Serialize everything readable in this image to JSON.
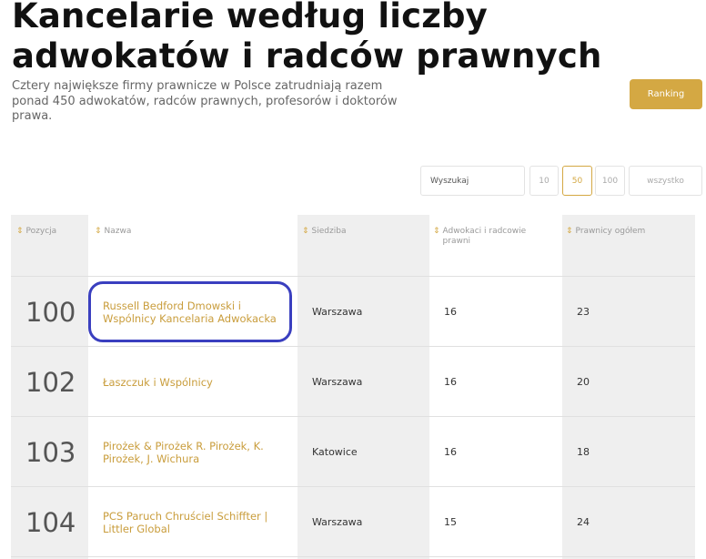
{
  "header": {
    "title": "Kancelarie według liczby adwokatów i radców prawnych",
    "subtitle": "Cztery największe firmy prawnicze w Polsce zatrudniają razem ponad 450 adwokatów, radców prawnych, profesorów i doktorów prawa.",
    "ranking_label": "Ranking"
  },
  "controls": {
    "search_placeholder": "Wyszukaj",
    "page_sizes": [
      "10",
      "50",
      "100",
      "wszystko"
    ],
    "active_page_size": "50"
  },
  "table": {
    "columns": [
      "Pozycja",
      "Nazwa",
      "Siedziba",
      "Adwokaci i radcowie prawni",
      "Prawnicy ogółem"
    ],
    "rows": [
      {
        "pos": "100",
        "name": "Russell Bedford Dmowski i Wspólnicy Kancelaria Adwokacka",
        "city": "Warszawa",
        "lawyers": "16",
        "total": "23"
      },
      {
        "pos": "102",
        "name": "Łaszczuk i Wspólnicy",
        "city": "Warszawa",
        "lawyers": "16",
        "total": "20"
      },
      {
        "pos": "103",
        "name": "Pirożek & Pirożek R. Pirożek, K. Pirożek, J. Wichura",
        "city": "Katowice",
        "lawyers": "16",
        "total": "18"
      },
      {
        "pos": "104",
        "name": "PCS Paruch Chruściel Schiffter | Littler Global",
        "city": "Warszawa",
        "lawyers": "15",
        "total": "24"
      }
    ]
  },
  "colors": {
    "accent": "#d4a843",
    "highlight": "#3a3fbf"
  }
}
